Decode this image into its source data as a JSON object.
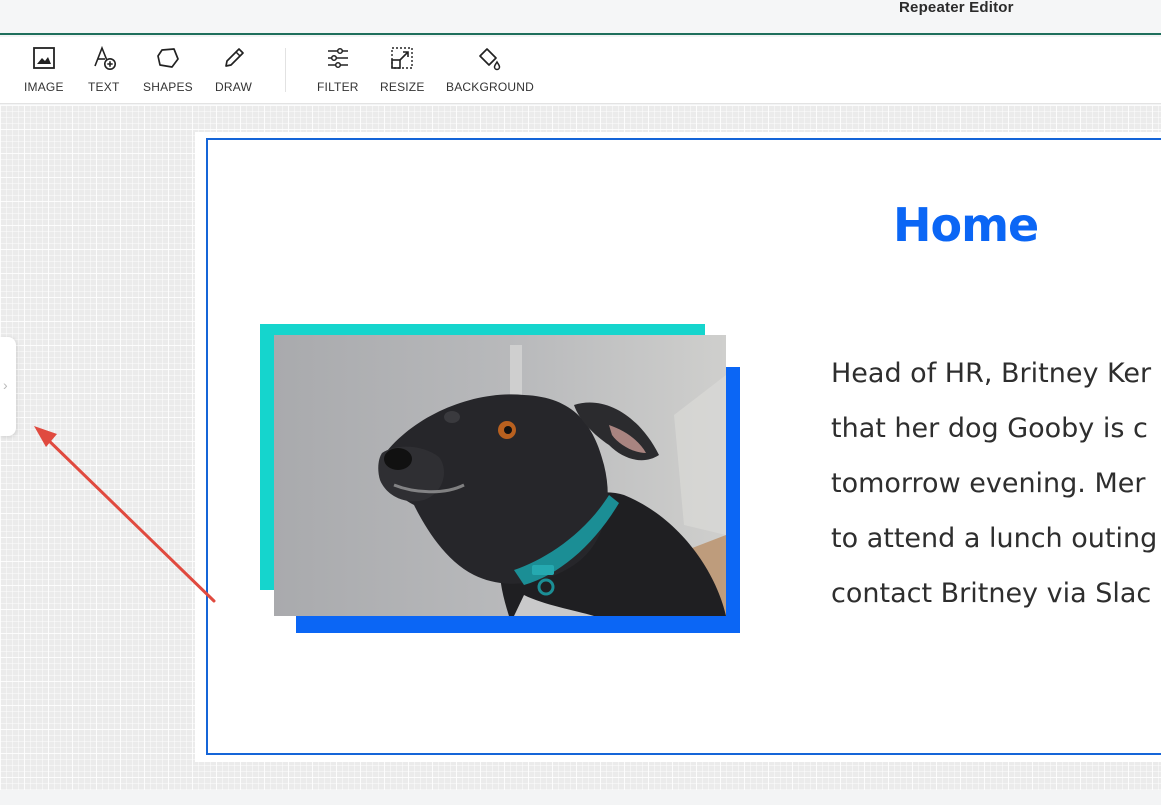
{
  "header": {
    "title": "Repeater Editor"
  },
  "toolbar": {
    "tools": [
      {
        "label": "IMAGE",
        "icon": "image-icon"
      },
      {
        "label": "TEXT",
        "icon": "text-add-icon"
      },
      {
        "label": "SHAPES",
        "icon": "shapes-icon"
      },
      {
        "label": "DRAW",
        "icon": "pencil-icon"
      },
      {
        "label": "FILTER",
        "icon": "sliders-icon"
      },
      {
        "label": "RESIZE",
        "icon": "resize-icon"
      },
      {
        "label": "BACKGROUND",
        "icon": "paint-bucket-icon"
      }
    ]
  },
  "design": {
    "heading": "Home",
    "body_lines": [
      "Head of HR, Britney Ker",
      "that her dog Gooby is c",
      "tomorrow evening. Mer",
      "to attend a lunch outing",
      "contact Britney via Slac"
    ],
    "photo_alt": "black dog with teal collar",
    "colors": {
      "accent_blue": "#0b66f5",
      "accent_teal": "#15d5cd",
      "border_blue": "#1565d8"
    }
  },
  "side_panel": {
    "toggle_glyph": "›"
  },
  "annotation": {
    "color": "#e04a3f"
  }
}
